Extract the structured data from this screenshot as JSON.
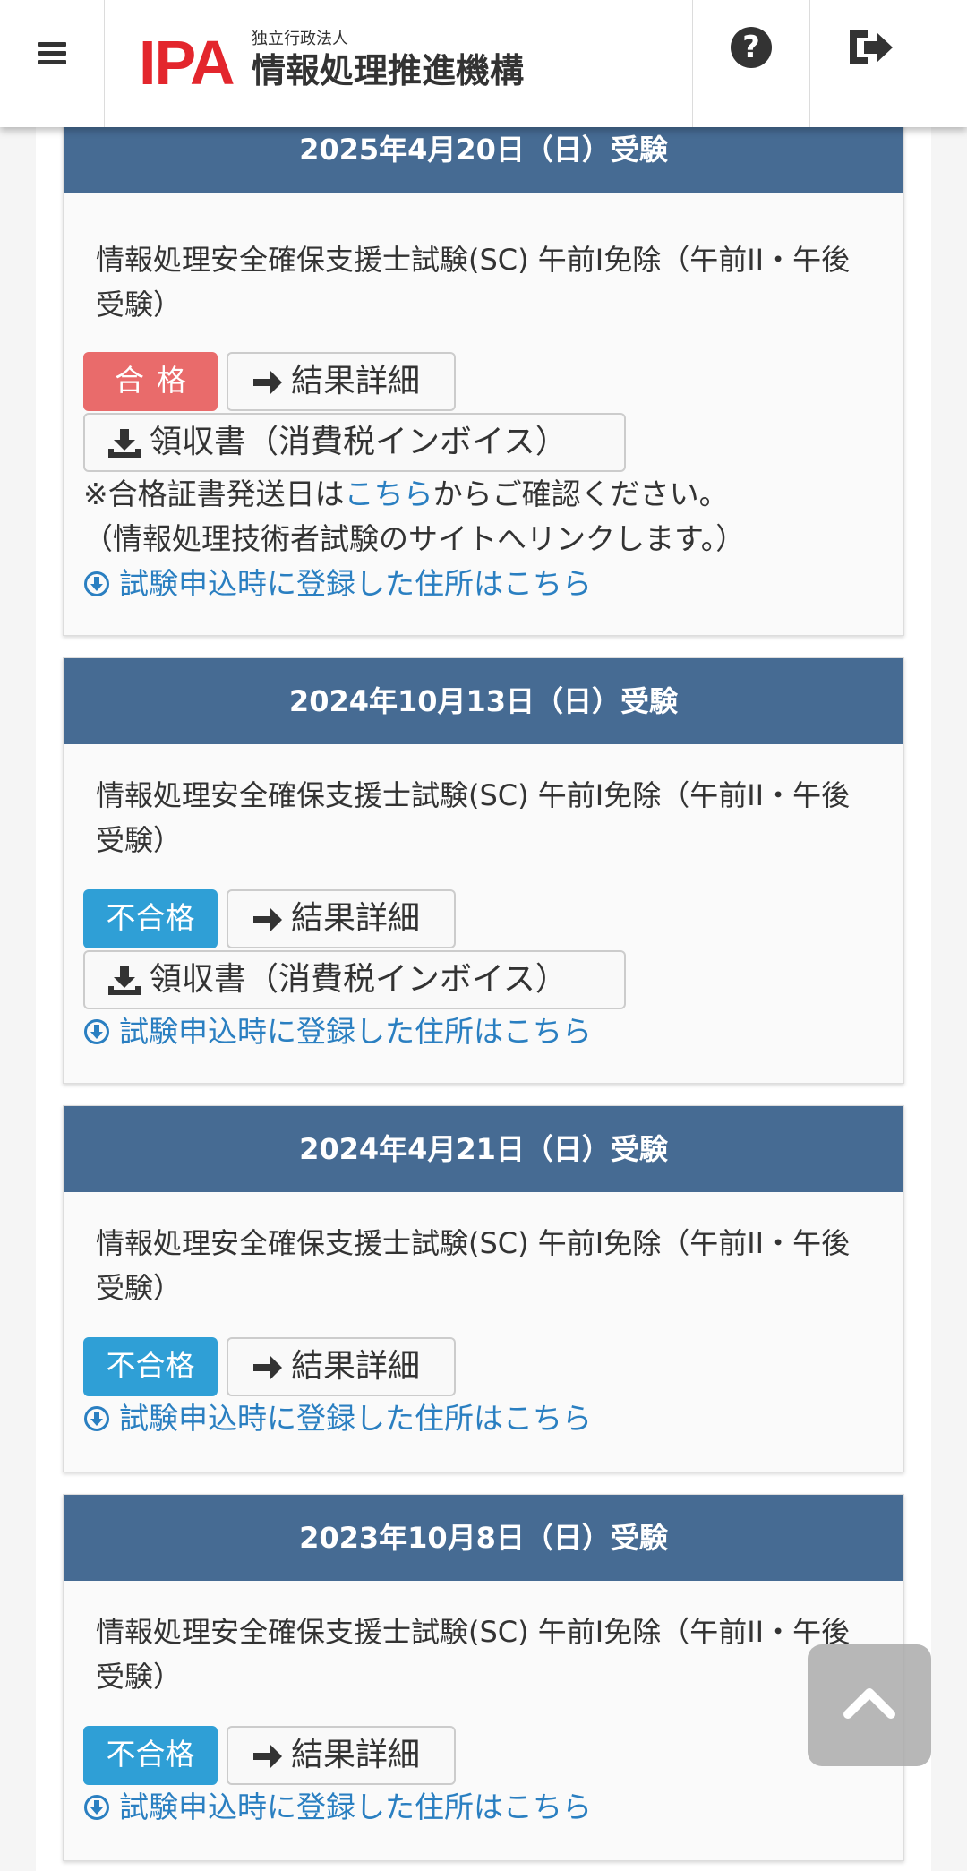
{
  "header": {
    "logo_mark": "IPA",
    "logo_sub": "独立行政法人",
    "logo_main": "情報処理推進機構",
    "help_glyph": "?"
  },
  "colors": {
    "card_header": "#466b93",
    "pass_badge": "#e96b6b",
    "fail_badge": "#2f9fd6",
    "link": "#2a7fc1",
    "logo_red": "#e3262d"
  },
  "results": [
    {
      "date": "2025年4月20日（日）受験",
      "exam_name": "情報処理安全確保支援士試験(SC) 午前I免除（午前II・午後受験）",
      "status": "合格",
      "status_type": "pass",
      "detail_label": "結果詳細",
      "receipt_label": "領収書（消費税インボイス）",
      "note_prefix": "※合格証書発送日は",
      "note_link": "こちら",
      "note_suffix": "からご確認ください。",
      "note_line2": "（情報処理技術者試験のサイトへリンクします。）",
      "address_link": "試験申込時に登録した住所はこちら"
    },
    {
      "date": "2024年10月13日（日）受験",
      "exam_name": "情報処理安全確保支援士試験(SC) 午前I免除（午前II・午後受験）",
      "status": "不合格",
      "status_type": "fail",
      "detail_label": "結果詳細",
      "receipt_label": "領収書（消費税インボイス）",
      "address_link": "試験申込時に登録した住所はこちら"
    },
    {
      "date": "2024年4月21日（日）受験",
      "exam_name": "情報処理安全確保支援士試験(SC) 午前I免除（午前II・午後受験）",
      "status": "不合格",
      "status_type": "fail",
      "detail_label": "結果詳細",
      "address_link": "試験申込時に登録した住所はこちら"
    },
    {
      "date": "2023年10月8日（日）受験",
      "exam_name": "情報処理安全確保支援士試験(SC) 午前I免除（午前II・午後受験）",
      "status": "不合格",
      "status_type": "fail",
      "detail_label": "結果詳細",
      "address_link": "試験申込時に登録した住所はこちら"
    }
  ]
}
